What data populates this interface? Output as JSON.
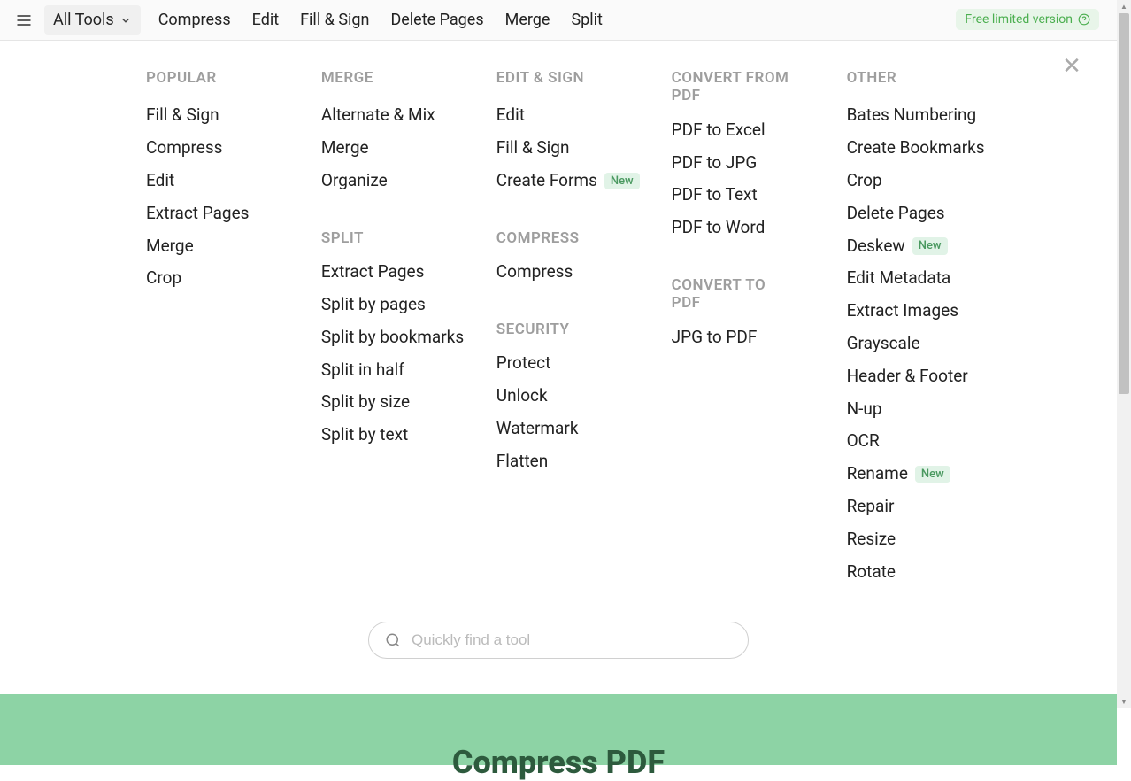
{
  "topbar": {
    "all_tools_label": "All Tools",
    "nav": [
      "Compress",
      "Edit",
      "Fill & Sign",
      "Delete Pages",
      "Merge",
      "Split"
    ],
    "free_version_label": "Free limited version"
  },
  "menu": {
    "popular": {
      "heading": "POPULAR",
      "items": [
        "Fill & Sign",
        "Compress",
        "Edit",
        "Extract Pages",
        "Merge",
        "Crop"
      ]
    },
    "merge": {
      "heading": "MERGE",
      "items": [
        "Alternate & Mix",
        "Merge",
        "Organize"
      ]
    },
    "split": {
      "heading": "SPLIT",
      "items": [
        "Extract Pages",
        "Split by pages",
        "Split by bookmarks",
        "Split in half",
        "Split by size",
        "Split by text"
      ]
    },
    "edit_sign": {
      "heading": "EDIT & SIGN",
      "items": [
        {
          "label": "Edit",
          "badge": null
        },
        {
          "label": "Fill & Sign",
          "badge": null
        },
        {
          "label": "Create Forms",
          "badge": "New"
        }
      ]
    },
    "compress": {
      "heading": "COMPRESS",
      "items": [
        "Compress"
      ]
    },
    "security": {
      "heading": "SECURITY",
      "items": [
        "Protect",
        "Unlock",
        "Watermark",
        "Flatten"
      ]
    },
    "convert_from": {
      "heading": "CONVERT FROM PDF",
      "items": [
        "PDF to Excel",
        "PDF to JPG",
        "PDF to Text",
        "PDF to Word"
      ]
    },
    "convert_to": {
      "heading": "CONVERT TO PDF",
      "items": [
        "JPG to PDF"
      ]
    },
    "other": {
      "heading": "OTHER",
      "items": [
        {
          "label": "Bates Numbering",
          "badge": null
        },
        {
          "label": "Create Bookmarks",
          "badge": null
        },
        {
          "label": "Crop",
          "badge": null
        },
        {
          "label": "Delete Pages",
          "badge": null
        },
        {
          "label": "Deskew",
          "badge": "New"
        },
        {
          "label": "Edit Metadata",
          "badge": null
        },
        {
          "label": "Extract Images",
          "badge": null
        },
        {
          "label": "Grayscale",
          "badge": null
        },
        {
          "label": "Header & Footer",
          "badge": null
        },
        {
          "label": "N-up",
          "badge": null
        },
        {
          "label": "OCR",
          "badge": null
        },
        {
          "label": "Rename",
          "badge": "New"
        },
        {
          "label": "Repair",
          "badge": null
        },
        {
          "label": "Resize",
          "badge": null
        },
        {
          "label": "Rotate",
          "badge": null
        }
      ]
    }
  },
  "search": {
    "placeholder": "Quickly find a tool"
  },
  "hero": {
    "title": "Compress PDF"
  }
}
